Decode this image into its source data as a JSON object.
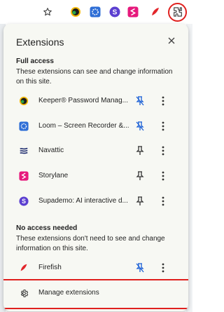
{
  "popup": {
    "title": "Extensions",
    "close_icon": "close-icon"
  },
  "full_access": {
    "title": "Full access",
    "description": "These extensions can see and change information on this site.",
    "items": [
      {
        "name": "Keeper® Password Manag...",
        "icon": "keeper-icon",
        "pinned": false
      },
      {
        "name": "Loom – Screen Recorder &...",
        "icon": "loom-icon",
        "pinned": false
      },
      {
        "name": "Navattic",
        "icon": "navattic-icon",
        "pinned": true
      },
      {
        "name": "Storylane",
        "icon": "storylane-icon",
        "pinned": true
      },
      {
        "name": "Supademo: AI interactive d...",
        "icon": "supademo-icon",
        "pinned": true
      }
    ]
  },
  "no_access": {
    "title": "No access needed",
    "description": "These extensions don't need to see and change information on this site.",
    "items": [
      {
        "name": "Firefish",
        "icon": "firefish-icon",
        "pinned": true
      }
    ]
  },
  "manage": {
    "label": "Manage extensions"
  },
  "colors": {
    "highlight": "#e0201e",
    "pin_blue": "#1a5fd6",
    "popup_bg": "#f7f8f3"
  }
}
